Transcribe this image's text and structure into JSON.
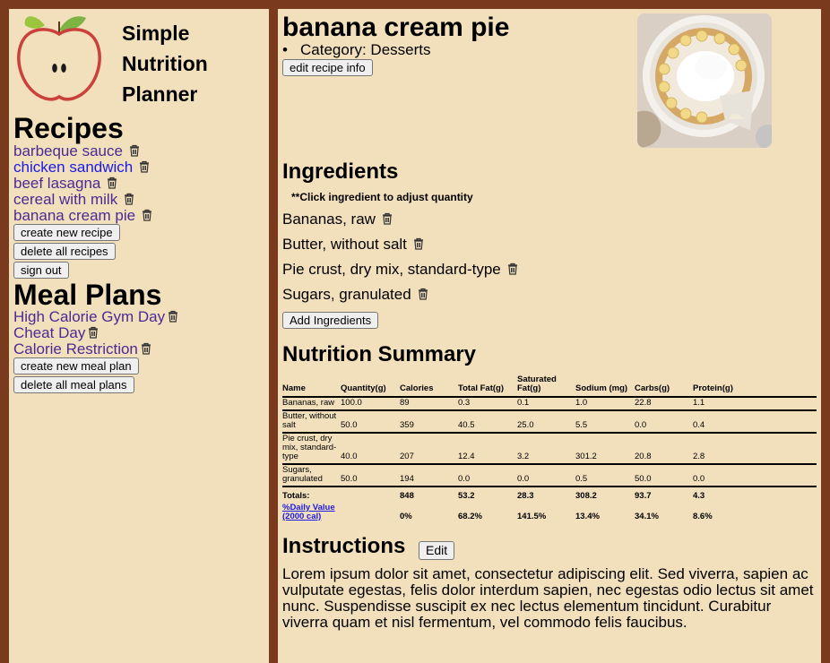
{
  "app": {
    "title_lines": [
      "Simple",
      "Nutrition",
      "Planner"
    ]
  },
  "sidebar": {
    "recipes_heading": "Recipes",
    "recipes": [
      {
        "label": "barbeque sauce",
        "visited": true
      },
      {
        "label": "chicken sandwich",
        "visited": false
      },
      {
        "label": "beef lasagna",
        "visited": true
      },
      {
        "label": "cereal with milk",
        "visited": true
      },
      {
        "label": "banana cream pie",
        "visited": true
      }
    ],
    "create_recipe_label": "create new recipe",
    "delete_recipes_label": "delete all recipes",
    "sign_out_label": "sign out",
    "meal_plans_heading": "Meal Plans",
    "meal_plans": [
      {
        "label": "High Calorie Gym Day"
      },
      {
        "label": "Cheat Day"
      },
      {
        "label": "Calorie Restriction"
      }
    ],
    "create_meal_plan_label": "create new meal plan",
    "delete_meal_plans_label": "delete all meal plans"
  },
  "recipe": {
    "title": "banana cream pie",
    "category": "Category: Desserts",
    "edit_info_label": "edit recipe info"
  },
  "ingredients": {
    "heading": "Ingredients",
    "note": "**Click ingredient to adjust quantity",
    "items": [
      "Bananas, raw",
      "Butter, without salt",
      "Pie crust, dry mix, standard-type",
      "Sugars, granulated"
    ],
    "add_label": "Add Ingredients"
  },
  "nutrition": {
    "heading": "Nutrition Summary",
    "columns": [
      "Name",
      "Quantity(g)",
      "Calories",
      "Total Fat(g)",
      "Saturated Fat(g)",
      "Sodium (mg)",
      "Carbs(g)",
      "Protein(g)"
    ],
    "rows": [
      [
        "Bananas, raw",
        "100.0",
        "89",
        "0.3",
        "0.1",
        "1.0",
        "22.8",
        "1.1"
      ],
      [
        "Butter, without salt",
        "50.0",
        "359",
        "40.5",
        "25.0",
        "5.5",
        "0.0",
        "0.4"
      ],
      [
        "Pie crust, dry mix, standard-type",
        "40.0",
        "207",
        "12.4",
        "3.2",
        "301.2",
        "20.8",
        "2.8"
      ],
      [
        "Sugars, granulated",
        "50.0",
        "194",
        "0.0",
        "0.0",
        "0.5",
        "50.0",
        "0.0"
      ]
    ],
    "totals": [
      "Totals:",
      "",
      "848",
      "53.2",
      "28.3",
      "308.2",
      "93.7",
      "4.3"
    ],
    "daily_value_label": "%Daily Value (2000 cal)",
    "daily_value": [
      "",
      "0%",
      "68.2%",
      "141.5%",
      "13.4%",
      "34.1%",
      "8.6%"
    ]
  },
  "instructions": {
    "heading": "Instructions",
    "edit_label": "Edit",
    "text": "Lorem ipsum dolor sit amet, consectetur adipiscing elit. Sed viverra, sapien ac vulputate egestas, felis dolor interdum sapien, nec egestas odio lectus sit amet nunc. Suspendisse suscipit ex nec lectus elementum tincidunt. Curabitur viverra quam et nisl fermentum, vel commodo felis faucibus."
  },
  "colors": {
    "frame": "#7a3a1e",
    "panel": "#f2e0bd",
    "visited_link": "#4b2a93",
    "link": "#1a1ae6",
    "apple_red": "#c9403c",
    "leaf_green": "#7cb342"
  },
  "icons": {
    "delete": "trash-icon",
    "logo": "apple-logo"
  }
}
